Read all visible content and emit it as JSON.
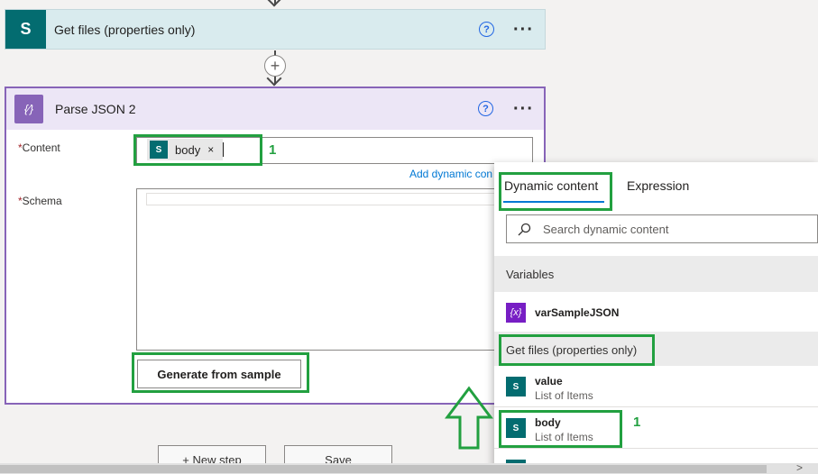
{
  "get_files_card": {
    "title": "Get files (properties only)",
    "icon_letter": "S",
    "help_glyph": "?",
    "more_glyph": "···"
  },
  "add_step": {
    "glyph": "+"
  },
  "parse_json_card": {
    "title": "Parse JSON 2",
    "icon_glyph": "{∕}",
    "help_glyph": "?",
    "more_glyph": "···",
    "content_label": "Content",
    "schema_label": "Schema",
    "required_mark": "*",
    "content_token": {
      "label": "body",
      "remove_glyph": "×",
      "icon_letter": "S"
    },
    "add_dynamic_link": "Add dynamic con",
    "generate_button": "Generate from sample"
  },
  "annotations": {
    "content_number": "1",
    "body_number": "1"
  },
  "dynamic_panel": {
    "tabs": [
      {
        "label": "Dynamic content",
        "selected": true
      },
      {
        "label": "Expression",
        "selected": false
      }
    ],
    "search_placeholder": "Search dynamic content",
    "sections": [
      {
        "header": "Variables",
        "items": [
          {
            "title": "varSampleJSON",
            "subtitle": "",
            "icon": "variable-icon"
          }
        ]
      },
      {
        "header": "Get files (properties only)",
        "items": [
          {
            "title": "value",
            "subtitle": "List of Items",
            "icon": "sharepoint-icon"
          },
          {
            "title": "body",
            "subtitle": "List of Items",
            "icon": "sharepoint-icon"
          }
        ]
      }
    ]
  },
  "bottom_buttons": [
    {
      "label": "+ New step"
    },
    {
      "label": "Save"
    }
  ],
  "colors": {
    "sharepoint": "#036c70",
    "parse_json": "#8764b8",
    "variable": "#771ec4",
    "annotation_green": "#22a040",
    "link_blue": "#0078d4"
  }
}
